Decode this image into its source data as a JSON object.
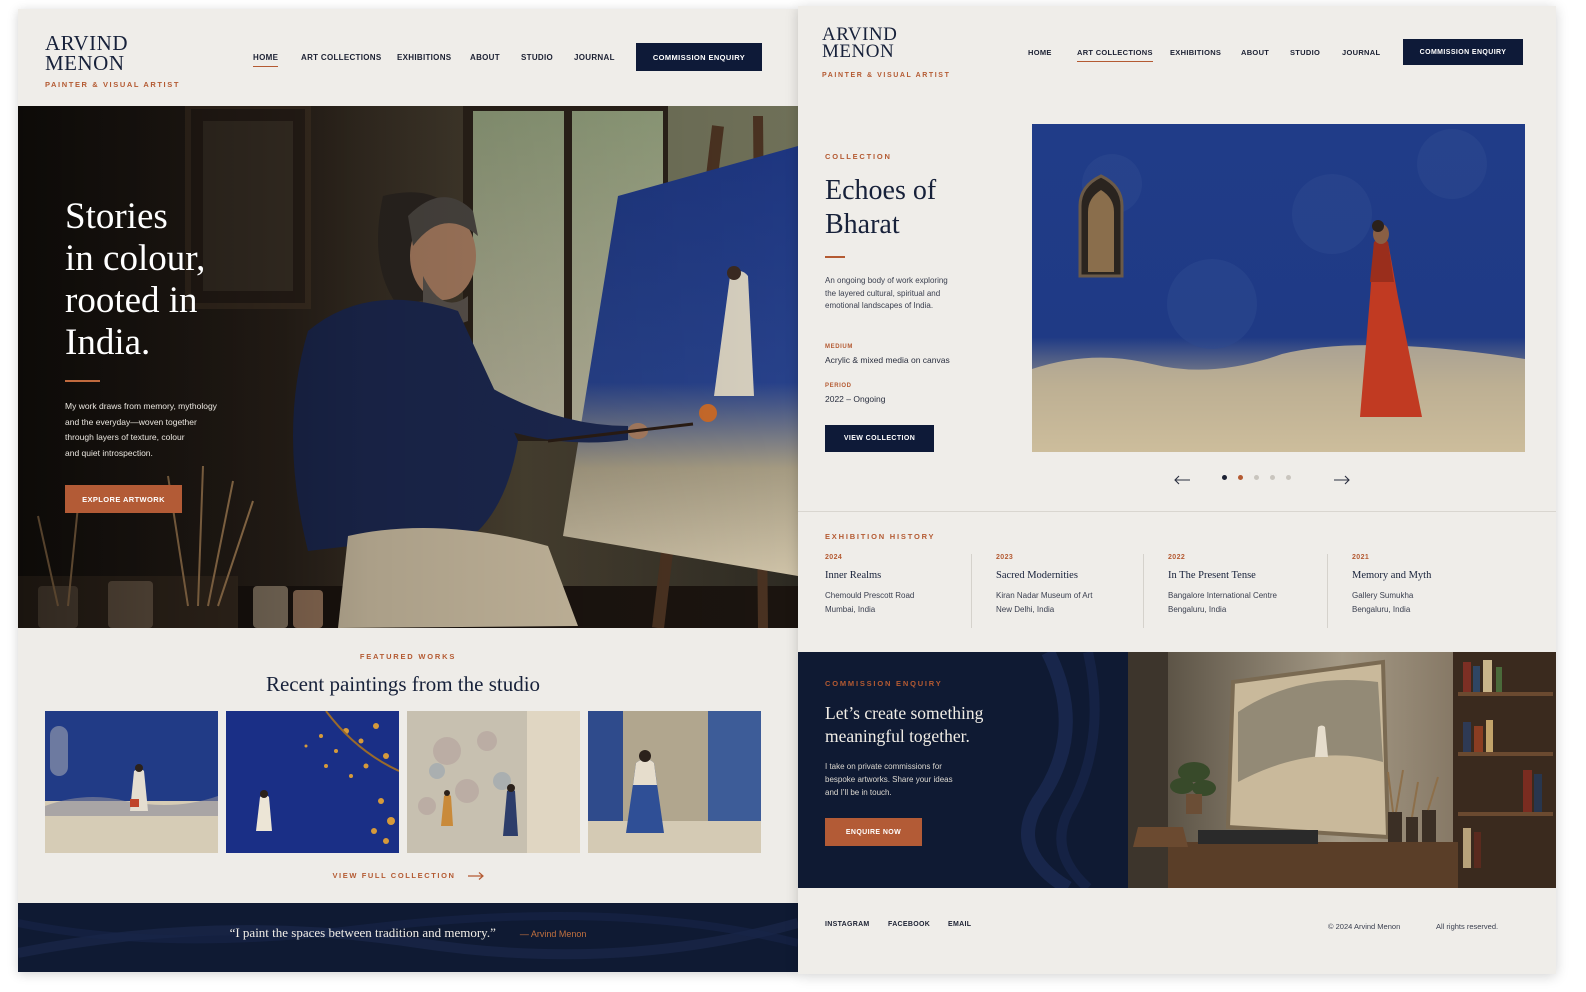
{
  "brand": {
    "name_line1": "ARVIND",
    "name_line2": "MENON",
    "tagline": "PAINTER & VISUAL ARTIST"
  },
  "nav": {
    "home": "HOME",
    "art_collections": "ART COLLECTIONS",
    "exhibitions": "EXHIBITIONS",
    "about": "ABOUT",
    "studio": "STUDIO",
    "journal": "JOURNAL",
    "cta": "COMMISSION ENQUIRY"
  },
  "hero": {
    "line1": "Stories",
    "line2": "in colour,",
    "line3": "rooted in",
    "line4": "India.",
    "body1": "My work draws from memory, mythology",
    "body2": "and the everyday—woven together",
    "body3": "through layers of texture, colour",
    "body4": "and quiet introspection.",
    "button": "EXPLORE ARTWORK"
  },
  "featured": {
    "eyebrow": "FEATURED WORKS",
    "title": "Recent paintings from the studio",
    "link": "VIEW FULL COLLECTION"
  },
  "quote": {
    "text": "“I paint the spaces between tradition and memory.”",
    "author": "— Arvind Menon"
  },
  "collection": {
    "eyebrow": "COLLECTION",
    "title1": "Echoes of",
    "title2": "Bharat",
    "desc1": "An ongoing body of work exploring",
    "desc2": "the layered cultural, spiritual and",
    "desc3": "emotional landscapes of India.",
    "medium_label": "MEDIUM",
    "medium": "Acrylic & mixed media on canvas",
    "period_label": "PERIOD",
    "period": "2022 – Ongoing",
    "button": "VIEW COLLECTION",
    "carousel_active_index": 2,
    "carousel_count": 5
  },
  "exhibitions": {
    "heading": "EXHIBITION HISTORY",
    "items": [
      {
        "year": "2024",
        "title": "Inner Realms",
        "venue": "Chemould Prescott Road",
        "city": "Mumbai, India"
      },
      {
        "year": "2023",
        "title": "Sacred Modernities",
        "venue": "Kiran Nadar Museum of Art",
        "city": "New Delhi, India"
      },
      {
        "year": "2022",
        "title": "In The Present Tense",
        "venue": "Bangalore International Centre",
        "city": "Bengaluru, India"
      },
      {
        "year": "2021",
        "title": "Memory and Myth",
        "venue": "Gallery Sumukha",
        "city": "Bengaluru, India"
      }
    ]
  },
  "commission": {
    "eyebrow": "COMMISSION ENQUIRY",
    "title1": "Let’s create something",
    "title2": "meaningful together.",
    "body1": "I take on private commissions for",
    "body2": "bespoke artworks. Share your ideas",
    "body3": "and I’ll be in touch.",
    "button": "ENQUIRE NOW"
  },
  "footer": {
    "instagram": "INSTAGRAM",
    "facebook": "FACEBOOK",
    "email": "EMAIL",
    "copyright": "© 2024 Arvind Menon",
    "rights": "All rights reserved."
  },
  "colors": {
    "navy": "#0e1a38",
    "rust": "#b35b36",
    "background": "#eeece8",
    "cobalt": "#23408c"
  }
}
